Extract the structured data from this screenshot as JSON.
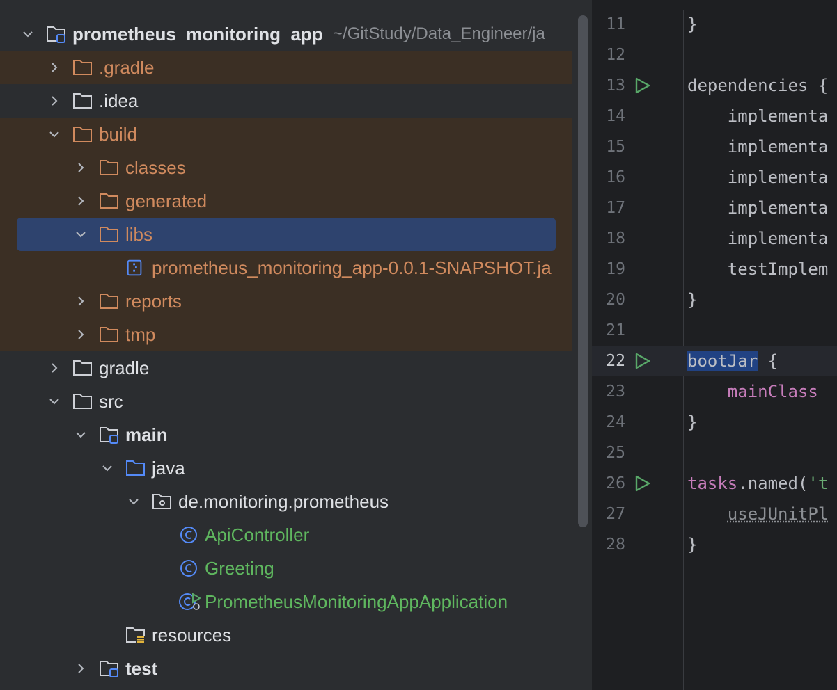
{
  "project_tree": {
    "root": {
      "name": "prometheus_monitoring_app",
      "path_hint": "~/GitStudy/Data_Engineer/ja"
    },
    "items": {
      "gradle_dot": ".gradle",
      "idea": ".idea",
      "build": "build",
      "classes": "classes",
      "generated": "generated",
      "libs": "libs",
      "jar": "prometheus_monitoring_app-0.0.1-SNAPSHOT.ja",
      "reports": "reports",
      "tmp": "tmp",
      "gradle": "gradle",
      "src": "src",
      "main": "main",
      "java": "java",
      "package": "de.monitoring.prometheus",
      "api_controller": "ApiController",
      "greeting": "Greeting",
      "app_application": "PrometheusMonitoringAppApplication",
      "resources": "resources",
      "test": "test"
    },
    "selected_item": "libs"
  },
  "editor": {
    "current_line": 22,
    "lines": [
      {
        "n": "11",
        "text": "}"
      },
      {
        "n": "12",
        "text": ""
      },
      {
        "n": "13",
        "text": "dependencies {",
        "run": true
      },
      {
        "n": "14",
        "text": "    implementa"
      },
      {
        "n": "15",
        "text": "    implementa"
      },
      {
        "n": "16",
        "text": "    implementa"
      },
      {
        "n": "17",
        "text": "    implementa"
      },
      {
        "n": "18",
        "text": "    implementa"
      },
      {
        "n": "19",
        "text": "    testImplem"
      },
      {
        "n": "20",
        "text": "}"
      },
      {
        "n": "21",
        "text": ""
      },
      {
        "n": "22",
        "kw": "bootJar",
        "rest": " {",
        "run": true
      },
      {
        "n": "23",
        "indent": "    ",
        "fn": "mainClass"
      },
      {
        "n": "24",
        "text": "}"
      },
      {
        "n": "25",
        "text": ""
      },
      {
        "n": "26",
        "fn": "tasks",
        "mid": ".named(",
        "str": "'t",
        "run": true
      },
      {
        "n": "27",
        "indent": "    ",
        "ul": "useJUnitPl"
      },
      {
        "n": "28",
        "text": "}"
      }
    ]
  },
  "colors": {
    "panel_bg": "#2b2d30",
    "editor_bg": "#1e1f22",
    "excluded_bg": "#3b2f24",
    "selection_bg": "#2e436e",
    "excluded_text": "#d08a5e",
    "class_text": "#5fb75f",
    "run_icon": "#59a869"
  }
}
